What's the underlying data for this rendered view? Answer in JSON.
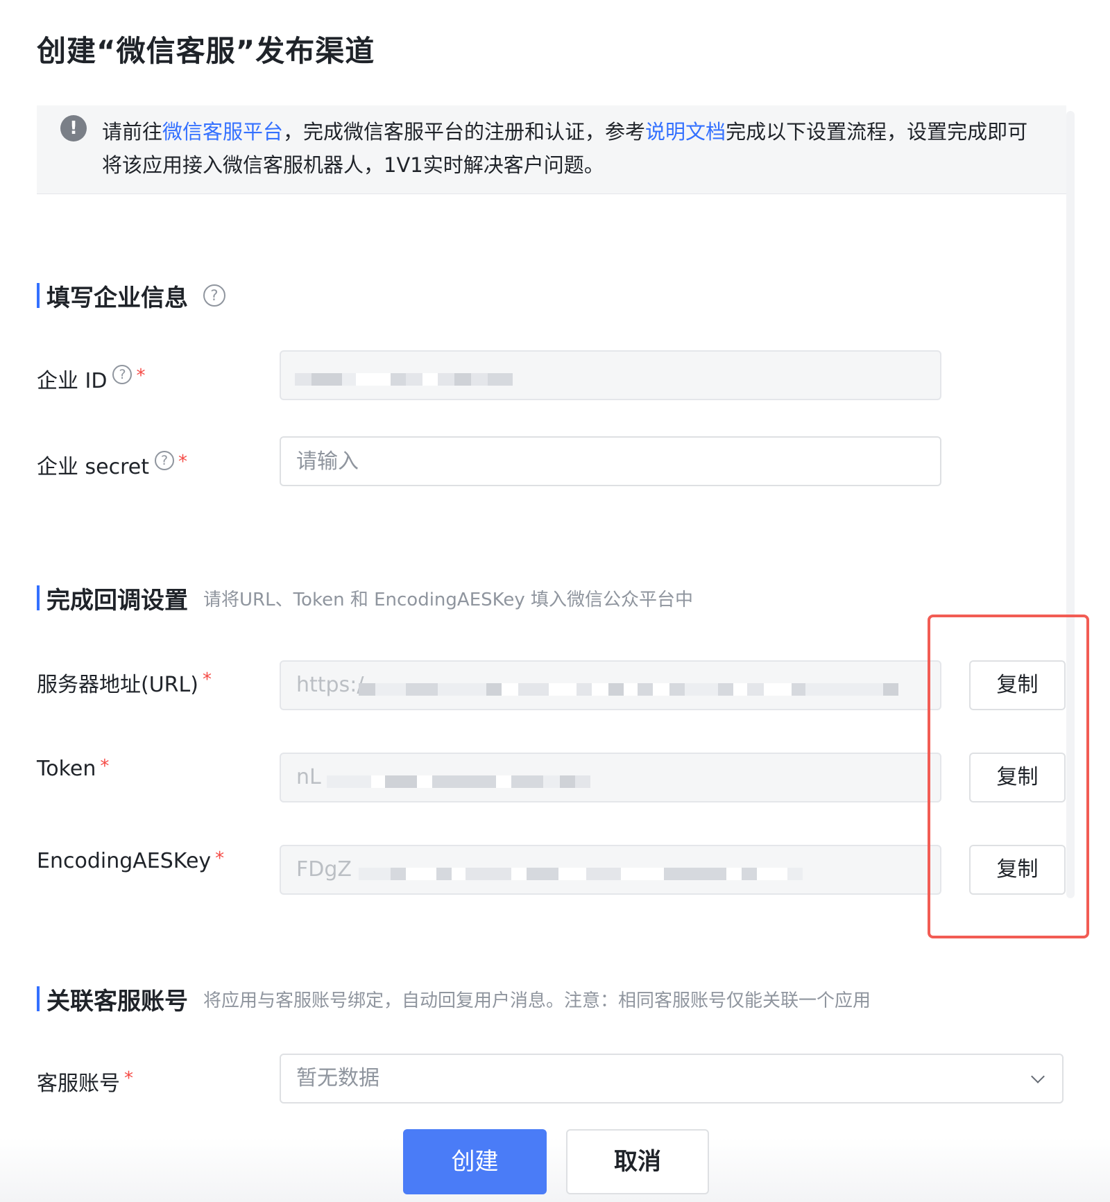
{
  "title": "创建“微信客服”发布渠道",
  "notice": {
    "text_prefix": "请前往",
    "link_platform": "微信客服平台",
    "text_middle": "，完成微信客服平台的注册和认证，参考",
    "link_docs": "说明文档",
    "text_suffix": "完成以下设置流程，设置完成即可将该应用接入微信客服机器人，1V1实时解决客户问题。"
  },
  "sections": {
    "enterprise": {
      "title": "填写企业信息"
    },
    "callback": {
      "title": "完成回调设置",
      "desc": "请将URL、Token 和 EncodingAESKey 填入微信公众平台中"
    },
    "account": {
      "title": "关联客服账号",
      "desc": "将应用与客服账号绑定，自动回复用户消息。注意：相同客服账号仅能关联一个应用"
    }
  },
  "fields": {
    "corp_id": {
      "label": "企业 ID",
      "required": "*"
    },
    "corp_secret": {
      "label": "企业 secret",
      "required": "*",
      "placeholder": "请输入"
    },
    "url": {
      "label": "服务器地址(URL)",
      "required": "*",
      "value": "https:/"
    },
    "token": {
      "label": "Token",
      "required": "*",
      "value": "nL"
    },
    "aes_key": {
      "label": "EncodingAESKey",
      "required": "*",
      "value": "FDgZ"
    },
    "service_account": {
      "label": "客服账号",
      "required": "*",
      "value": "暂无数据"
    }
  },
  "copy_label": "复制",
  "actions": {
    "create": "创建",
    "cancel": "取消"
  },
  "icons": {
    "notice": "exclamation-icon",
    "help": "question-icon",
    "dropdown": "chevron-down-icon"
  },
  "colors": {
    "primary": "#4a7cf7",
    "link": "#3370ff",
    "required": "#f54a45",
    "highlight": "#f25c54"
  }
}
